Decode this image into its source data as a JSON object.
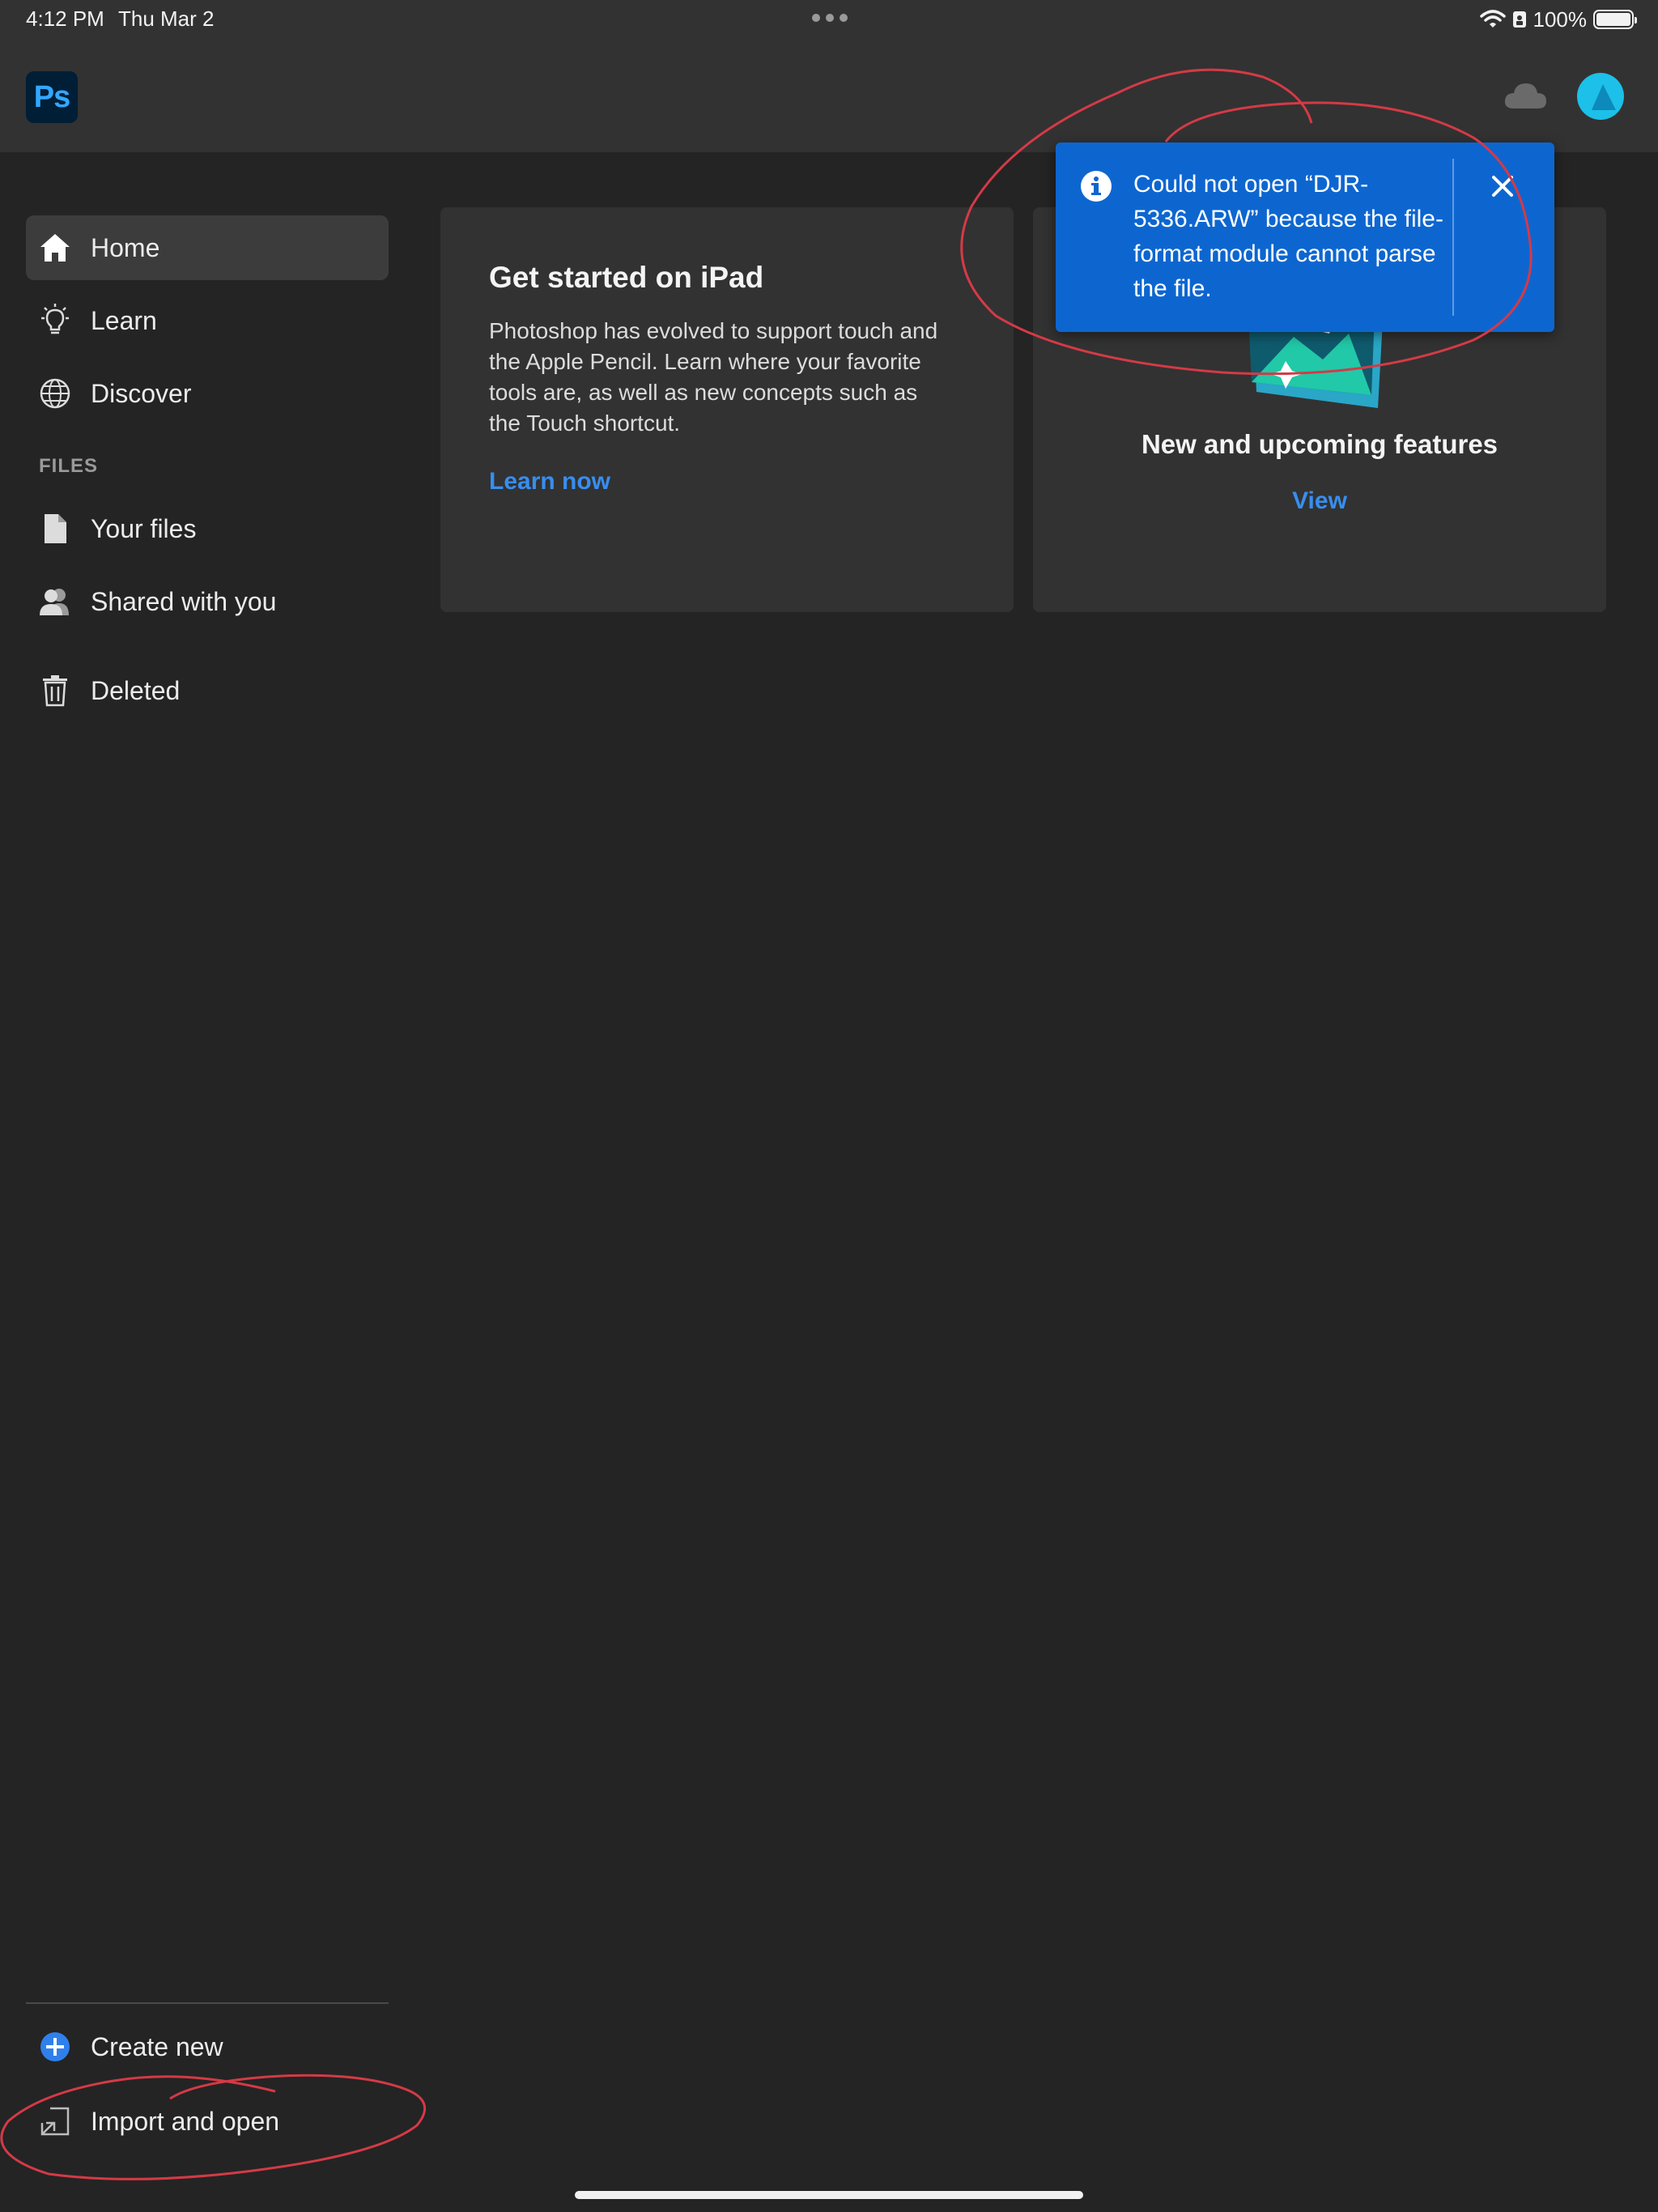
{
  "status_bar": {
    "time": "4:12 PM",
    "date": "Thu Mar 2",
    "battery": "100%"
  },
  "app": {
    "logo_text": "Ps"
  },
  "sidebar": {
    "items": [
      {
        "label": "Home",
        "icon": "home-icon",
        "active": true
      },
      {
        "label": "Learn",
        "icon": "lightbulb-icon"
      },
      {
        "label": "Discover",
        "icon": "globe-icon"
      }
    ],
    "files_section_label": "FILES",
    "file_items": [
      {
        "label": "Your files",
        "icon": "file-icon"
      },
      {
        "label": "Shared with you",
        "icon": "users-icon"
      },
      {
        "label": "Deleted",
        "icon": "trash-icon"
      }
    ],
    "bottom_actions": [
      {
        "label": "Create new",
        "icon": "plus-circle-icon"
      },
      {
        "label": "Import and open",
        "icon": "import-icon"
      }
    ]
  },
  "cards": {
    "get_started": {
      "title": "Get started on iPad",
      "body": "Photoshop has evolved to support touch and the Apple Pencil. Learn where your favorite tools are, as well as new concepts such as the Touch shortcut.",
      "link": "Learn now"
    },
    "features": {
      "title": "New and upcoming features",
      "link": "View"
    }
  },
  "toast": {
    "message": "Could not open “DJR-5336.ARW” because the file-format module cannot parse the file."
  },
  "colors": {
    "background": "#242424",
    "header": "#323232",
    "accent_link": "#378ef0",
    "toast_bg": "#0d66d0",
    "annotation_red": "#d43a46"
  }
}
